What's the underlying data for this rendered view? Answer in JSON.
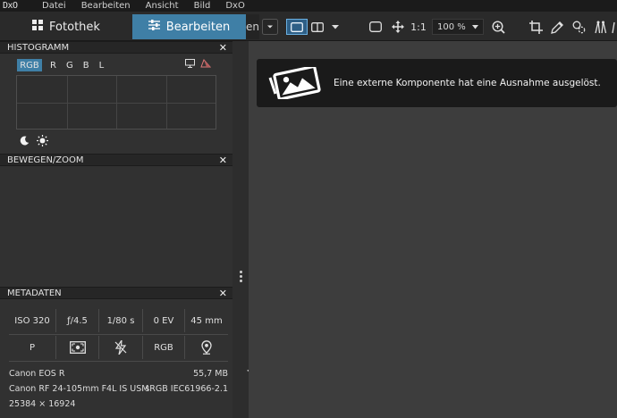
{
  "app": {
    "logo": "DxO"
  },
  "menu": [
    "Datei",
    "Bearbeiten",
    "Ansicht",
    "Bild",
    "DxO"
  ],
  "tabs": {
    "fotothek": "Fotothek",
    "bearbeiten": "Bearbeiten",
    "peek": "en"
  },
  "toolbar": {
    "ratio_label": "1:1",
    "zoom_value": "100 %",
    "icons": [
      "compare-single-icon",
      "compare-split-icon",
      "crop-frame-icon",
      "move-icon",
      "zoom-fit-icon",
      "crop-icon",
      "picker-icon",
      "repair-icon",
      "horizon-icon"
    ]
  },
  "histogram": {
    "title": "HISTOGRAMM",
    "channels": [
      "RGB",
      "R",
      "G",
      "B",
      "L"
    ],
    "active_channel": "RGB"
  },
  "move_zoom": {
    "title": "BEWEGEN/ZOOM"
  },
  "metadata": {
    "title": "METADATEN",
    "row1": [
      "ISO 320",
      "ƒ/4.5",
      "1/80 s",
      "0 EV",
      "45 mm"
    ],
    "row2_text": [
      "P",
      "RGB"
    ],
    "camera": "Canon EOS R",
    "file_size": "55,7 MB",
    "lens": "Canon RF 24-105mm F4L IS USM",
    "color_profile": "sRGB IEC61966-2.1",
    "dimensions": "25384 × 16924"
  },
  "canvas": {
    "error_message": "Eine externe Komponente hat eine Ausnahme ausgelöst."
  },
  "colors": {
    "accent": "#3f7fa6",
    "panel": "#313131",
    "canvas": "#3d3d3d"
  }
}
